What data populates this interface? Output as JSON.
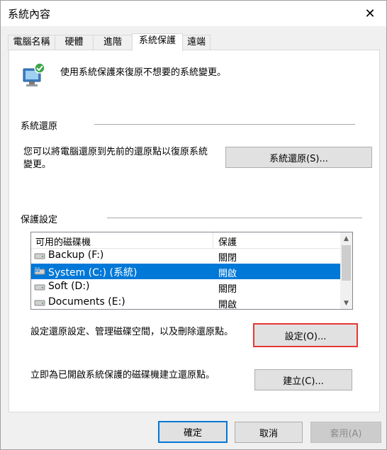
{
  "window": {
    "title": "系統內容",
    "close_glyph": "✕"
  },
  "tabs": [
    {
      "label": "電腦名稱"
    },
    {
      "label": "硬體"
    },
    {
      "label": "進階"
    },
    {
      "label": "系統保護"
    },
    {
      "label": "遠端"
    }
  ],
  "active_tab": "系統保護",
  "header": {
    "text": "使用系統保護來復原不想要的系統變更。",
    "icon": "system-protection-icon"
  },
  "restore": {
    "group_label": "系統還原",
    "description_line1": "您可以將電腦還原到先前的還原點以復原系統",
    "description_line2": "變更。",
    "button_label": "系統還原(S)..."
  },
  "protection": {
    "group_label": "保護設定",
    "columns": [
      "可用的磁碟機",
      "保護"
    ],
    "drives": [
      {
        "name": "Backup (F:)",
        "status": "關閉",
        "selected": false,
        "icon": "drive-icon"
      },
      {
        "name": "System (C:) (系統)",
        "status": "開啟",
        "selected": true,
        "icon": "windows-drive-icon"
      },
      {
        "name": "Soft (D:)",
        "status": "關閉",
        "selected": false,
        "icon": "drive-icon"
      },
      {
        "name": "Documents (E:)",
        "status": "開啟",
        "selected": false,
        "icon": "drive-icon"
      }
    ],
    "configure_text": "設定還原設定、管理磁碟空間，以及刪除還原點。",
    "configure_button": "設定(O)...",
    "create_text": "立即為已開啟系統保護的磁碟機建立還原點。",
    "create_button": "建立(C)..."
  },
  "footer": {
    "ok": "確定",
    "cancel": "取消",
    "apply": "套用(A)"
  },
  "colors": {
    "selection": "#0078d7",
    "highlight_border": "#e53935"
  }
}
